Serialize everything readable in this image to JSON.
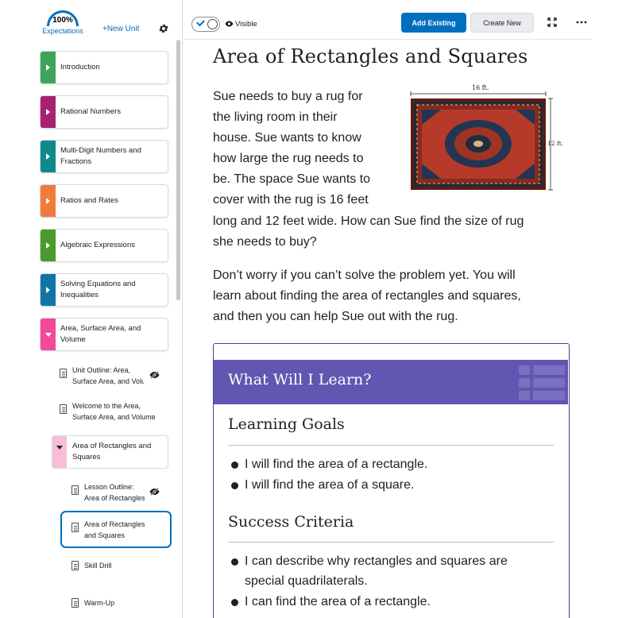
{
  "sidebar": {
    "expectations": {
      "percent": "100%",
      "label": "Expectations"
    },
    "new_unit": "+New Unit",
    "units": [
      {
        "label": "Introduction",
        "color": "#3fa45b"
      },
      {
        "label": "Rational Numbers",
        "color": "#a7226e"
      },
      {
        "label": "Multi-Digit Numbers and",
        "label2": "Fractions",
        "color": "#0f8a8a"
      },
      {
        "label": "Ratios and Rates",
        "color": "#f07c3a"
      },
      {
        "label": "Algebraic Expressions",
        "color": "#4b9a2b"
      },
      {
        "label": "Solving Equations and",
        "label2": "Inequalities",
        "color": "#1174a6"
      },
      {
        "label": "Area, Surface Area, and",
        "label2": "Volume",
        "color": "#f2499b"
      }
    ],
    "topics": [
      {
        "line1": "Unit Outline: Area,",
        "line2": "Surface Area, and Volume"
      },
      {
        "line1": "Welcome to the Area,",
        "line2": "Surface Area, and Volume"
      }
    ],
    "subunit": {
      "line1": "Area of Rectangles and",
      "line2": "Squares"
    },
    "lessons": [
      {
        "line1": "Lesson Outline:",
        "line2": "Area of Rectangles and Squares"
      },
      {
        "line1": "Area of Rectangles",
        "line2": "and Squares"
      },
      {
        "line1": "Skill Drill"
      },
      {
        "line1": "Warm-Up"
      }
    ]
  },
  "toolbar": {
    "visibility_label": "Visible",
    "add_existing": "Add Existing",
    "create_new": "Create New"
  },
  "content": {
    "title": "Area of Rectangles and Squares",
    "intro_lines": [
      "Sue needs to buy a rug for",
      "the living room in their",
      "house. Sue wants to know",
      "how large the rug needs to",
      "be. The space Sue wants to",
      "cover with the rug is 16 feet",
      "long and 12 feet wide. How can Sue find the size of rug",
      "she needs to buy?"
    ],
    "rug": {
      "width_label": "16 ft.",
      "height_label": "12 ft."
    },
    "para2_lines": [
      "Don’t worry if you can’t solve the problem yet. You will",
      "learn about finding the area of rectangles and squares,",
      "and then you can help Sue out with the rug."
    ],
    "learn_box": {
      "heading": "What Will I Learn?",
      "goals_heading": "Learning Goals",
      "goals": [
        "I will find the area of a rectangle.",
        "I will find the area of a square."
      ],
      "criteria_heading": "Success Criteria",
      "criteria_lines": [
        "I can describe why rectangles and squares are",
        "special quadrilaterals.",
        "I can find the area of a rectangle."
      ]
    }
  },
  "colors": {
    "accent": "#006fbf",
    "banner": "#6257b0"
  }
}
